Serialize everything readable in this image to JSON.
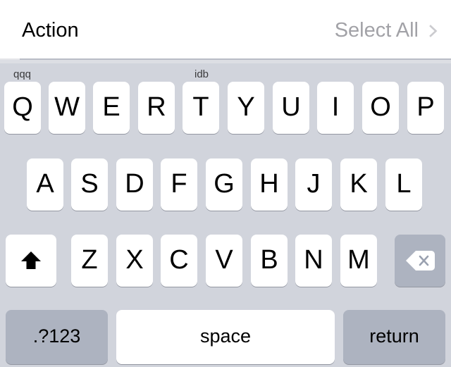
{
  "header": {
    "title": "Action",
    "select_all_label": "Select All",
    "chevron_icon": "chevron-right-icon"
  },
  "keyboard": {
    "overlay_labels": [
      {
        "text": "qqq"
      },
      {
        "text": "idb"
      }
    ],
    "row1": [
      {
        "label": "Q"
      },
      {
        "label": "W"
      },
      {
        "label": "E"
      },
      {
        "label": "R"
      },
      {
        "label": "T"
      },
      {
        "label": "Y"
      },
      {
        "label": "U"
      },
      {
        "label": "I"
      },
      {
        "label": "O"
      },
      {
        "label": "P"
      }
    ],
    "row2": [
      {
        "label": "A"
      },
      {
        "label": "S"
      },
      {
        "label": "D"
      },
      {
        "label": "F"
      },
      {
        "label": "G"
      },
      {
        "label": "H"
      },
      {
        "label": "J"
      },
      {
        "label": "K"
      },
      {
        "label": "L"
      }
    ],
    "row3": [
      {
        "label": "Z"
      },
      {
        "label": "X"
      },
      {
        "label": "C"
      },
      {
        "label": "V"
      },
      {
        "label": "B"
      },
      {
        "label": "N"
      },
      {
        "label": "M"
      }
    ],
    "shift_icon": "shift-arrow-icon",
    "delete_icon": "delete-backward-icon",
    "numbers_label": ".?123",
    "space_label": "space",
    "return_label": "return"
  },
  "colors": {
    "keyboard_background": "#d1d4dc",
    "light_key": "#ffffff",
    "dark_key": "#adb3c0",
    "key_text": "#000000",
    "muted_text": "#a2a2a7",
    "header_background": "#ffffff"
  }
}
